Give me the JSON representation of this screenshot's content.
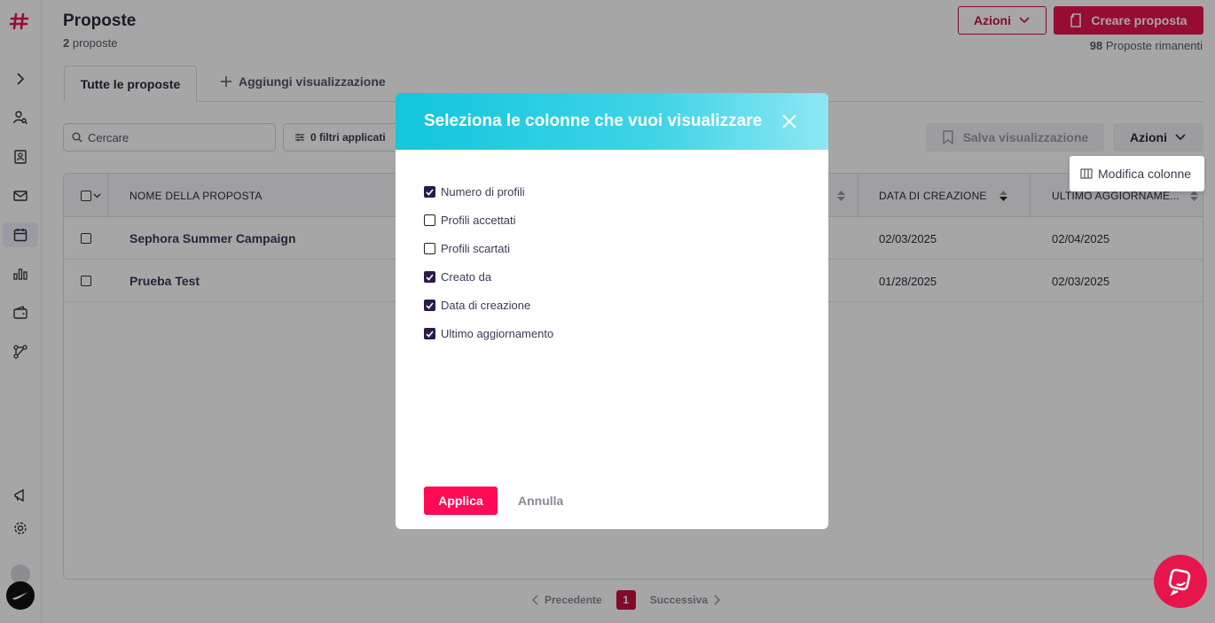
{
  "header": {
    "title": "Proposte",
    "count": "2",
    "count_label": "proposte",
    "azioni_label": "Azioni",
    "create_label": "Creare proposta",
    "remaining_count": "98",
    "remaining_label": "Proposte rimanenti"
  },
  "tabs": {
    "active": "Tutte le proposte",
    "add": "Aggiungi visualizzazione"
  },
  "toolbar": {
    "search_placeholder": "Cercare",
    "filters_label": "0 filtri applicati",
    "save_view_label": "Salva visualizzazione",
    "azioni_label": "Azioni",
    "dropdown_item": "Modifica colonne"
  },
  "table": {
    "columns": [
      "NOME DELLA PROPOSTA",
      "DATA DI CREAZIONE",
      "ULTIMO AGGIORNAME..."
    ],
    "rows": [
      {
        "name": "Sephora Summer Campaign",
        "created": "02/03/2025",
        "updated": "02/04/2025"
      },
      {
        "name": "Prueba Test",
        "created": "01/28/2025",
        "updated": "02/03/2025"
      }
    ]
  },
  "pagination": {
    "prev": "Precedente",
    "current": "1",
    "next": "Successiva"
  },
  "modal": {
    "title": "Seleziona le colonne che vuoi visualizzare",
    "options": [
      {
        "label": "Numero di profili",
        "checked": true
      },
      {
        "label": "Profili accettati",
        "checked": false
      },
      {
        "label": "Profili scartati",
        "checked": false
      },
      {
        "label": "Creato da",
        "checked": true
      },
      {
        "label": "Data di creazione",
        "checked": true
      },
      {
        "label": "Ultimo aggiornamento",
        "checked": true
      }
    ],
    "apply_label": "Applica",
    "cancel_label": "Annulla"
  },
  "colors": {
    "brand": "#e6154c",
    "modal_header": "#12c6dc",
    "checkbox_checked": "#2b1a4a"
  }
}
